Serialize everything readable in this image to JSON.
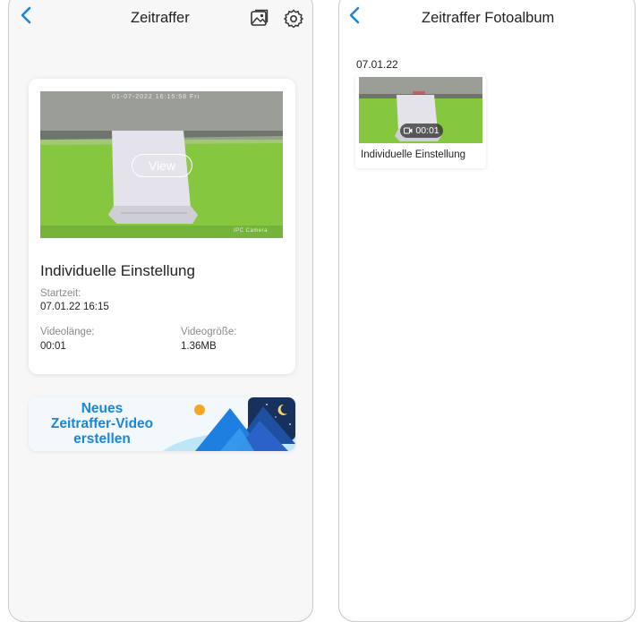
{
  "left": {
    "title": "Zeitraffer",
    "card": {
      "view_label": "View",
      "preview_timestamp": "01-07-2022 16:15:58 Fri",
      "preview_camera_label": "IPC Camera",
      "title": "Individuelle Einstellung",
      "start_label": "Startzeit:",
      "start_value": "07.01.22 16:15",
      "length_label": "Videolänge:",
      "length_value": "00:01",
      "size_label": "Videogröße:",
      "size_value": "1.36MB"
    },
    "banner": {
      "line1": "Neues",
      "line2": "Zeitraffer-Video",
      "line3": "erstellen"
    }
  },
  "right": {
    "title": "Zeitraffer Fotoalbum",
    "date": "07.01.22",
    "item": {
      "duration": "00:01",
      "caption": "Individuelle Einstellung"
    }
  },
  "colors": {
    "accent": "#1a86d8",
    "wall_green": "#7ebf3a",
    "text": "#222222",
    "muted": "#8a8a8a"
  },
  "icons": [
    "back-arrow-icon",
    "gallery-icon",
    "settings-gear-icon",
    "video-camera-icon"
  ]
}
